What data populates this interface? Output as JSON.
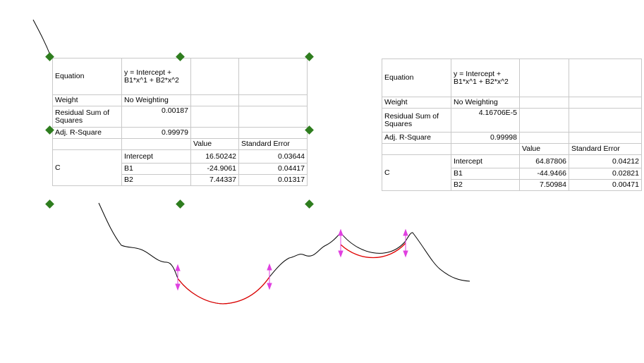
{
  "chart_data": {
    "type": "line",
    "series": [
      {
        "role": "data-curve",
        "color": "#000000"
      },
      {
        "role": "fit-curve-1",
        "color": "#e00000"
      },
      {
        "role": "fit-curve-2",
        "color": "#e00000"
      }
    ],
    "fit_range_markers": {
      "color": "#e040e0"
    },
    "grid": false,
    "legend": "none"
  },
  "tables": [
    {
      "equation_label": "Equation",
      "equation_value": "y = Intercept + B1*x^1 + B2*x^2",
      "weight_label": "Weight",
      "weight_value": "No Weighting",
      "rss_label": "Residual Sum of Squares",
      "rss_value": "0.00187",
      "adjr_label": "Adj. R-Square",
      "adjr_value": "0.99979",
      "value_header": "Value",
      "stderr_header": "Standard Error",
      "param_group": "C",
      "params": [
        {
          "name": "Intercept",
          "value": "16.50242",
          "stderr": "0.03644"
        },
        {
          "name": "B1",
          "value": "-24.9061",
          "stderr": "0.04417"
        },
        {
          "name": "B2",
          "value": "7.44337",
          "stderr": "0.01317"
        }
      ],
      "selected": true
    },
    {
      "equation_label": "Equation",
      "equation_value": "y = Intercept + B1*x^1 + B2*x^2",
      "weight_label": "Weight",
      "weight_value": "No Weighting",
      "rss_label": "Residual Sum of Squares",
      "rss_value": "4.16706E-5",
      "adjr_label": "Adj. R-Square",
      "adjr_value": "0.99998",
      "value_header": "Value",
      "stderr_header": "Standard Error",
      "param_group": "C",
      "params": [
        {
          "name": "Intercept",
          "value": "64.87806",
          "stderr": "0.04212"
        },
        {
          "name": "B1",
          "value": "-44.9466",
          "stderr": "0.02821"
        },
        {
          "name": "B2",
          "value": "7.50984",
          "stderr": "0.00471"
        }
      ],
      "selected": false
    }
  ],
  "colors": {
    "selection_handle": "#2e7d1e",
    "table_border": "#c8c8c8"
  }
}
